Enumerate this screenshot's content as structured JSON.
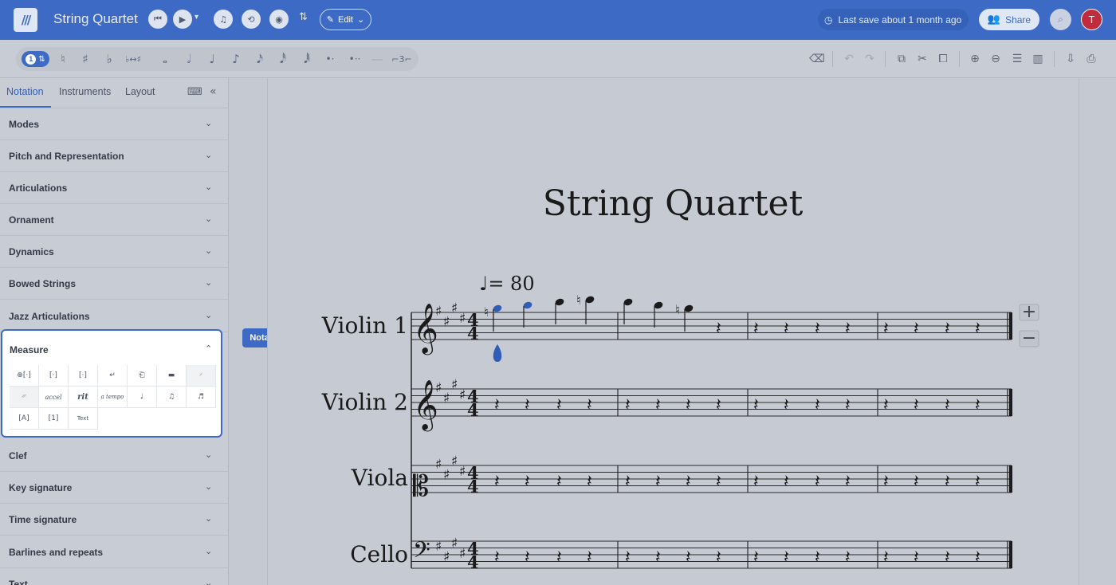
{
  "app": {
    "logo": "///",
    "title": "String Quartet",
    "edit_label": "Edit",
    "save_status": "Last save about 1 month ago",
    "share_label": "Share",
    "avatar_initial": "T"
  },
  "toolbar": {
    "voice_number": "1"
  },
  "sidebar": {
    "tabs": [
      "Notation",
      "Instruments",
      "Layout"
    ],
    "sections": [
      "Modes",
      "Pitch and Representation",
      "Articulations",
      "Ornament",
      "Dynamics",
      "Bowed Strings",
      "Jazz Articulations",
      "Measure",
      "Clef",
      "Key signature",
      "Time signature",
      "Barlines and repeats",
      "Text"
    ],
    "measure_tools": {
      "accel": "accel",
      "rit": "rit",
      "atempo": "a tempo",
      "text_box": "Text"
    }
  },
  "tooltip": "Notation → Measure",
  "score": {
    "title": "String Quartet",
    "tempo_mark": "♩= 80",
    "tempo": 80,
    "instruments": [
      "Violin 1",
      "Violin 2",
      "Viola",
      "Cello"
    ],
    "key_signature_sharps": 4,
    "time_signature": "4/4"
  },
  "colors": {
    "accent": "#3d6ac4",
    "avatar": "#c02c3c"
  }
}
